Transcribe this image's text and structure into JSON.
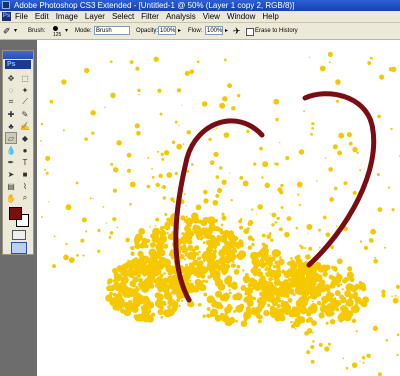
{
  "titlebar": {
    "title": "Adobe Photoshop CS3 Extended - [Untitled-1 @ 50% (Layer 1 copy 2, RGB/8)]"
  },
  "menu": [
    "File",
    "Edit",
    "Image",
    "Layer",
    "Select",
    "Filter",
    "Analysis",
    "View",
    "Window",
    "Help"
  ],
  "options": {
    "brush_label": "Brush:",
    "brush_size": "125",
    "mode_label": "Mode:",
    "mode_value": "Brush",
    "opacity_label": "Opacity:",
    "opacity_value": "100%",
    "flow_label": "Flow:",
    "flow_value": "100%",
    "erase_history_label": "Erase to History",
    "erase_history_checked": false
  },
  "toolbox": {
    "logo": "Ps"
  },
  "colors": {
    "foreground": "#7a0f10",
    "background": "#ffffff",
    "splatter": "#f5c800",
    "heart": "#7a0d12"
  }
}
